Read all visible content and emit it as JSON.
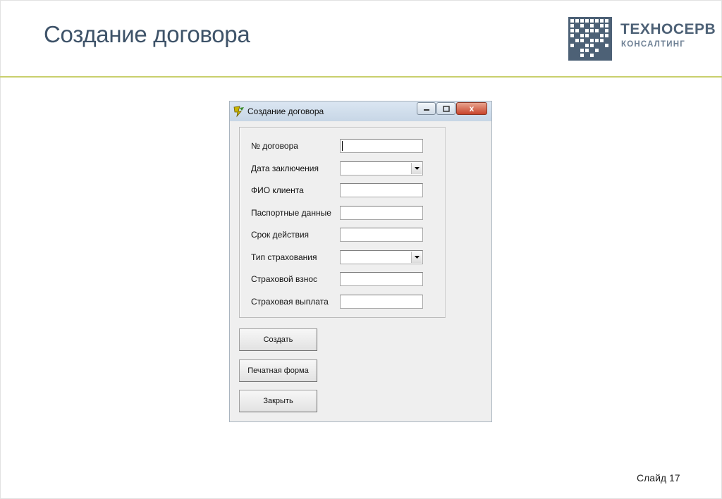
{
  "slide": {
    "title": "Создание договора",
    "number_label": "Слайд 17"
  },
  "logo": {
    "name": "ТЕХНОСЕРВ",
    "subtitle": "КОНСАЛТИНГ",
    "color": "#4d6176"
  },
  "window": {
    "title": "Создание договора",
    "controls": {
      "close_label": "x"
    },
    "fields": [
      {
        "label": "№ договора",
        "type": "text",
        "value": ""
      },
      {
        "label": "Дата заключения",
        "type": "combo",
        "value": ""
      },
      {
        "label": "ФИО клиента",
        "type": "text",
        "value": ""
      },
      {
        "label": "Паспортные данные",
        "type": "text",
        "value": ""
      },
      {
        "label": "Срок действия",
        "type": "text",
        "value": ""
      },
      {
        "label": "Тип страхования",
        "type": "combo",
        "value": ""
      },
      {
        "label": "Страховой взнос",
        "type": "text",
        "value": ""
      },
      {
        "label": "Страховая выплата",
        "type": "text",
        "value": ""
      }
    ],
    "buttons": {
      "create": "Создать",
      "print_form": "Печатная форма",
      "close": "Закрыть"
    }
  },
  "colors": {
    "header_line": "#c9cf6d",
    "title_text": "#3e5369"
  }
}
